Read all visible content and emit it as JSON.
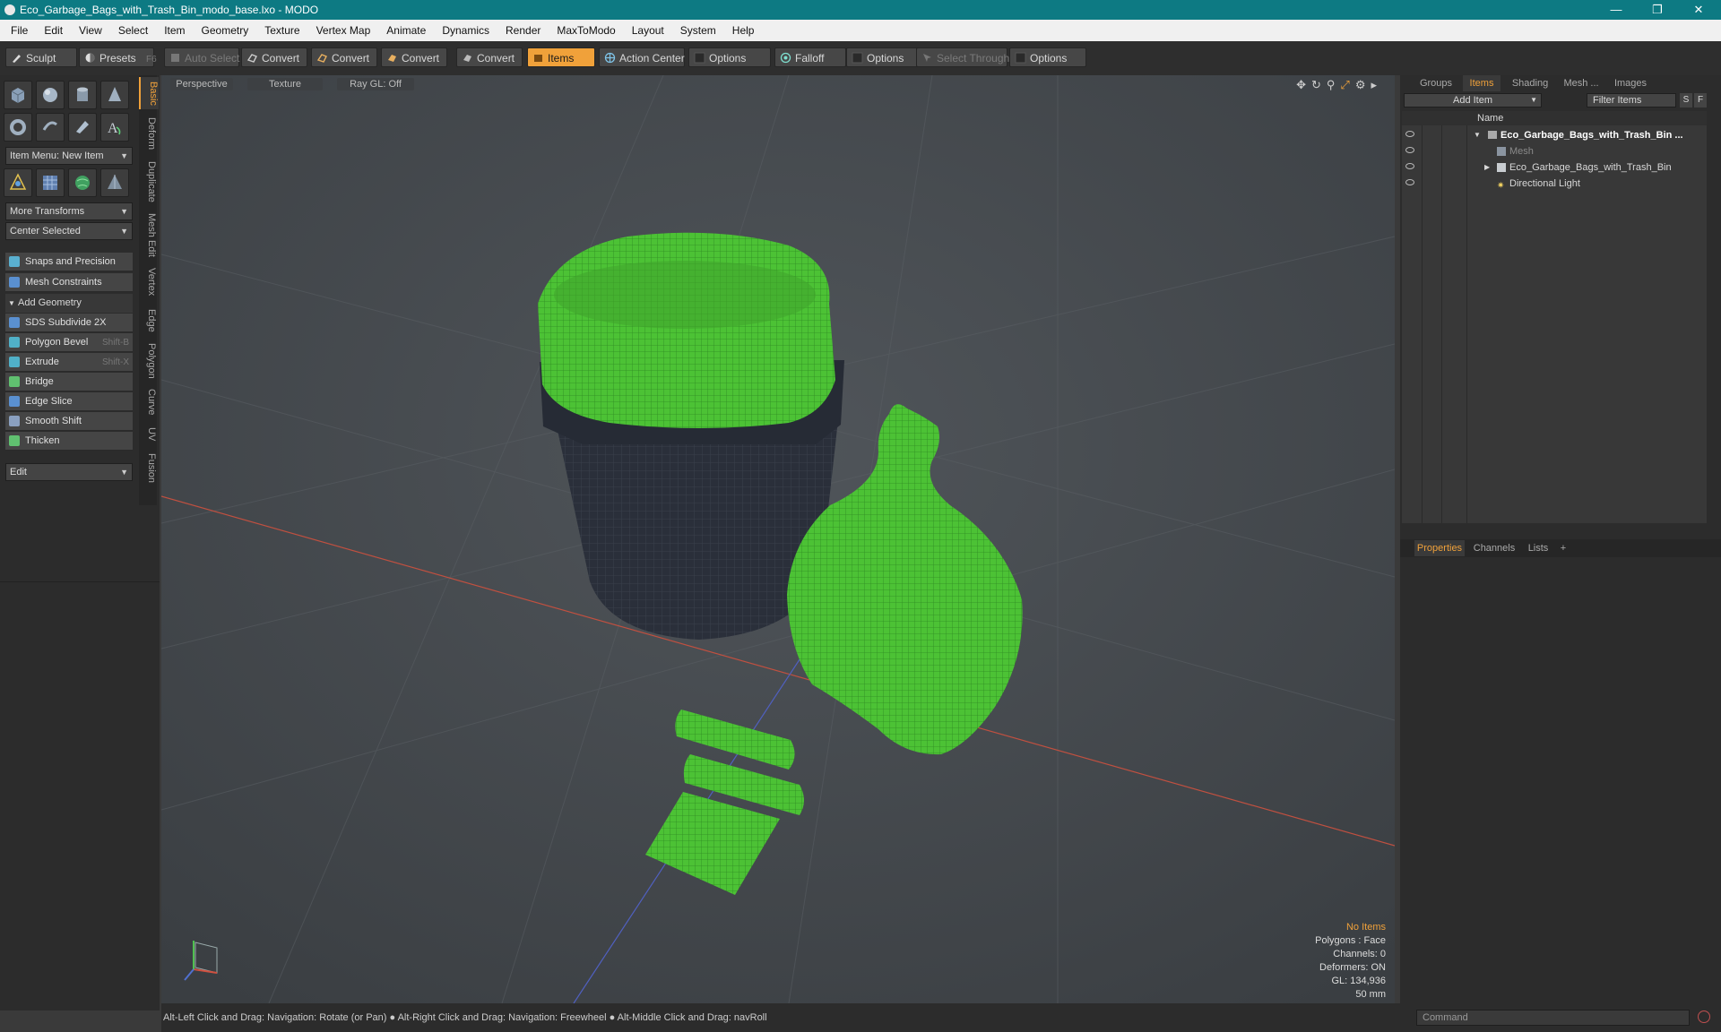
{
  "window": {
    "title": "Eco_Garbage_Bags_with_Trash_Bin_modo_base.lxo - MODO",
    "minimize": "—",
    "maximize": "❐",
    "close": "✕"
  },
  "menu": [
    "File",
    "Edit",
    "View",
    "Select",
    "Item",
    "Geometry",
    "Texture",
    "Vertex Map",
    "Animate",
    "Dynamics",
    "Render",
    "MaxToModo",
    "Layout",
    "System",
    "Help"
  ],
  "toolbar": {
    "sculpt": "Sculpt",
    "presets": "Presets",
    "presets_shortcut": "F6",
    "auto_select": "Auto Select",
    "convert1": "Convert",
    "convert2": "Convert",
    "convert3": "Convert",
    "convert4": "Convert",
    "items": "Items",
    "action_center": "Action Center",
    "options1": "Options",
    "falloff": "Falloff",
    "options2": "Options",
    "select_through": "Select Through",
    "options3": "Options"
  },
  "left_panel": {
    "tabs": [
      "Basic",
      "Deform",
      "Duplicate",
      "Mesh Edit",
      "Vertex",
      "Edge",
      "Polygon",
      "Curve",
      "UV",
      "Fusion"
    ],
    "item_menu": "Item Menu: New Item",
    "more_transforms": "More Transforms",
    "center_selected": "Center Selected",
    "snaps": "Snaps and Precision",
    "mesh_constraints": "Mesh Constraints",
    "add_geometry": "Add Geometry",
    "tools": [
      {
        "label": "SDS Subdivide 2X",
        "shortcut": ""
      },
      {
        "label": "Polygon Bevel",
        "shortcut": "Shift-B"
      },
      {
        "label": "Extrude",
        "shortcut": "Shift-X"
      },
      {
        "label": "Bridge",
        "shortcut": ""
      },
      {
        "label": "Edge Slice",
        "shortcut": ""
      },
      {
        "label": "Smooth Shift",
        "shortcut": ""
      },
      {
        "label": "Thicken",
        "shortcut": ""
      }
    ],
    "edit_dropdown": "Edit"
  },
  "viewport": {
    "tabs": [
      "Perspective",
      "Texture",
      "Ray GL: Off"
    ],
    "hud": {
      "selection": "No Items",
      "polygons": "Polygons : Face",
      "channels": "Channels: 0",
      "deformers": "Deformers: ON",
      "gl": "GL: 134,936",
      "scale": "50 mm"
    }
  },
  "status_bar": "Alt-Left Click and Drag: Navigation: Rotate (or Pan) ● Alt-Right Click and Drag: Navigation: Freewheel ● Alt-Middle Click and Drag: navRoll",
  "right_panel": {
    "tabs": [
      "Groups",
      "Items",
      "Shading",
      "Mesh ...",
      "Images"
    ],
    "add_item": "Add Item",
    "filter_items": "Filter Items",
    "filter_s": "S",
    "filter_f": "F",
    "column_name": "Name",
    "tree": [
      {
        "label": "Eco_Garbage_Bags_with_Trash_Bin ...",
        "bold": true
      },
      {
        "label": "Mesh",
        "dim": true
      },
      {
        "label": "Eco_Garbage_Bags_with_Trash_Bin"
      },
      {
        "label": "Directional Light"
      }
    ],
    "bottom_tabs": [
      "Properties",
      "Channels",
      "Lists"
    ],
    "command_placeholder": "Command"
  },
  "colors": {
    "accent": "#f0a13a",
    "title_bar": "#0d7a83",
    "mesh_green": "#4cc235",
    "bin_dark": "#2a2f3a"
  }
}
